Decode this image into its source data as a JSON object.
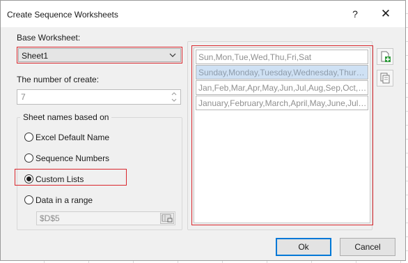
{
  "window": {
    "title": "Create Sequence Worksheets",
    "help_label": "?",
    "close_label": "✕"
  },
  "base_worksheet": {
    "label": "Base Worksheet:",
    "value": "Sheet1"
  },
  "number_to_create": {
    "label": "The number of create:",
    "value": "7"
  },
  "sheet_names": {
    "legend": "Sheet names based on",
    "options": [
      {
        "label": "Excel Default Name",
        "checked": false
      },
      {
        "label": "Sequence Numbers",
        "checked": false
      },
      {
        "label": "Custom Lists",
        "checked": true
      },
      {
        "label": "Data in a range",
        "checked": false
      }
    ],
    "range_value": "$D$5"
  },
  "custom_lists": {
    "items": [
      "Sun,Mon,Tue,Wed,Thu,Fri,Sat",
      "Sunday,Monday,Tuesday,Wednesday,Thursday,Friday,Saturday",
      "Jan,Feb,Mar,Apr,May,Jun,Jul,Aug,Sep,Oct,Nov,Dec",
      "January,February,March,April,May,June,July,August,September,October,November,December"
    ],
    "selected_index": 1
  },
  "side_buttons": {
    "add_icon": "add-list-icon",
    "copy_icon": "copy-list-icon"
  },
  "buttons": {
    "ok": "Ok",
    "cancel": "Cancel"
  },
  "colors": {
    "highlight_red": "#d9262c",
    "selected_row": "#cfe1f4",
    "default_button_border": "#0078d7"
  }
}
